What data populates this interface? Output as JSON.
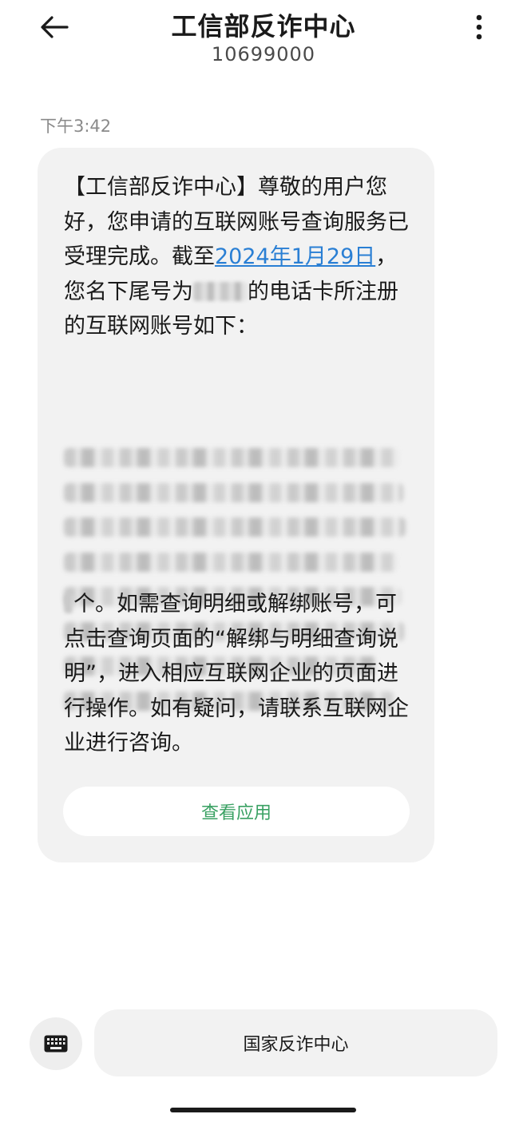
{
  "header": {
    "title": "工信部反诈中心",
    "number": "10699000"
  },
  "conversation": {
    "timestamp": "下午3:42",
    "message": {
      "part1": "【工信部反诈中心】尊敬的用户您好，您申请的互联网账号查询服务已受理完成。截至",
      "date_link": "2024年1月29日",
      "part2": "，您名下尾号为",
      "part3": "的电话卡所注册的互联网账号如下：",
      "part4": "个。如需查询明细或解绑账号，可点击查询页面的“解绑与明细查询说明”，进入相应互联网企业的页面进行操作。如有疑问，请联系互联网企业进行咨询。"
    },
    "action_button": "查看应用"
  },
  "composer": {
    "quick_reply": "国家反诈中心"
  },
  "icons": {
    "back": "back-arrow-icon",
    "more": "more-vertical-icon",
    "keyboard": "keyboard-icon"
  },
  "colors": {
    "link": "#2a7fd4",
    "action_text": "#3aa163",
    "bubble_bg": "#f2f2f2"
  }
}
